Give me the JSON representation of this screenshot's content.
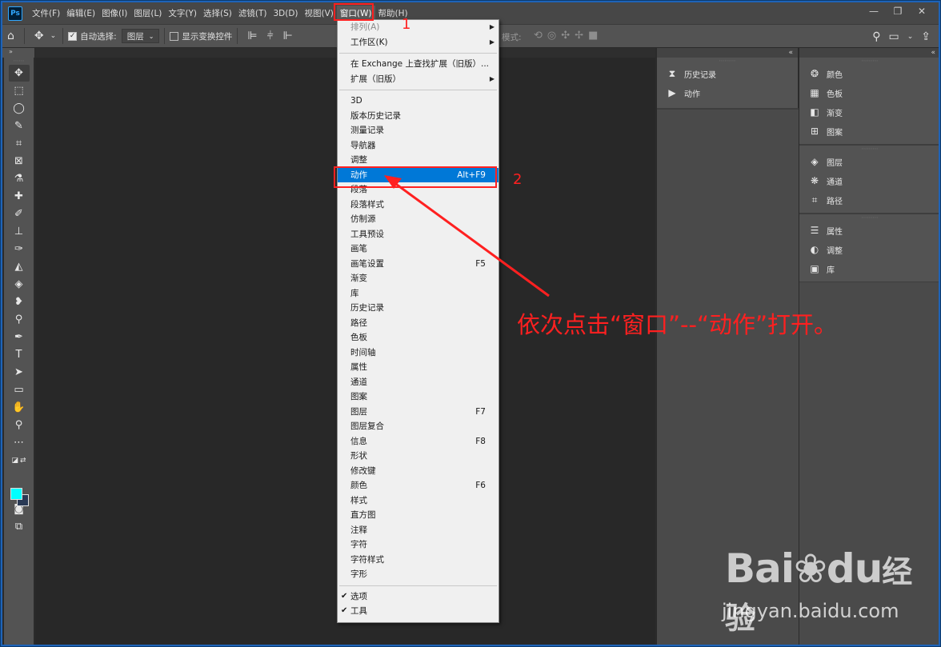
{
  "app": {
    "logo": "Ps"
  },
  "menubar": {
    "items": [
      "文件(F)",
      "编辑(E)",
      "图像(I)",
      "图层(L)",
      "文字(Y)",
      "选择(S)",
      "滤镜(T)",
      "3D(D)",
      "视图(V)",
      "窗口(W)",
      "帮助(H)"
    ],
    "active": "窗口(W)"
  },
  "window_controls": {
    "minimize": "—",
    "restore": "❐",
    "close": "✕"
  },
  "options": {
    "auto_select_label": "自动选择:",
    "layer_select": "图层",
    "show_transform_label": "显示变换控件",
    "mode_label": "模式:"
  },
  "dropdown": {
    "group1": [
      {
        "label": "排列(A)",
        "submenu": true,
        "disabled": true
      },
      {
        "label": "工作区(K)",
        "submenu": true
      }
    ],
    "group2": [
      {
        "label": "在 Exchange 上查找扩展（旧版）..."
      },
      {
        "label": "扩展（旧版）",
        "submenu": true
      }
    ],
    "group3": [
      {
        "label": "3D"
      },
      {
        "label": "版本历史记录"
      },
      {
        "label": "测量记录"
      },
      {
        "label": "导航器"
      },
      {
        "label": "调整"
      },
      {
        "label": "动作",
        "shortcut": "Alt+F9",
        "highlight": true
      },
      {
        "label": "段落"
      },
      {
        "label": "段落样式"
      },
      {
        "label": "仿制源"
      },
      {
        "label": "工具预设"
      },
      {
        "label": "画笔"
      },
      {
        "label": "画笔设置",
        "shortcut": "F5"
      },
      {
        "label": "渐变"
      },
      {
        "label": "库"
      },
      {
        "label": "历史记录"
      },
      {
        "label": "路径"
      },
      {
        "label": "色板"
      },
      {
        "label": "时间轴"
      },
      {
        "label": "属性"
      },
      {
        "label": "通道"
      },
      {
        "label": "图案"
      },
      {
        "label": "图层",
        "shortcut": "F7"
      },
      {
        "label": "图层复合"
      },
      {
        "label": "信息",
        "shortcut": "F8"
      },
      {
        "label": "形状"
      },
      {
        "label": "修改键"
      },
      {
        "label": "颜色",
        "shortcut": "F6"
      },
      {
        "label": "样式"
      },
      {
        "label": "直方图"
      },
      {
        "label": "注释"
      },
      {
        "label": "字符"
      },
      {
        "label": "字符样式"
      },
      {
        "label": "字形"
      }
    ],
    "group4": [
      {
        "label": "选项",
        "checked": true
      },
      {
        "label": "工具",
        "checked": true
      }
    ]
  },
  "panels": {
    "col1": [
      {
        "icon": "history-icon",
        "glyph": "⧗",
        "label": "历史记录"
      },
      {
        "icon": "play-icon",
        "glyph": "▶",
        "label": "动作"
      }
    ],
    "col2_groups": [
      [
        {
          "icon": "color-icon",
          "glyph": "❂",
          "label": "颜色"
        },
        {
          "icon": "swatches-icon",
          "glyph": "▦",
          "label": "色板"
        },
        {
          "icon": "gradient-icon",
          "glyph": "◧",
          "label": "渐变"
        },
        {
          "icon": "pattern-icon",
          "glyph": "⊞",
          "label": "图案"
        }
      ],
      [
        {
          "icon": "layers-icon",
          "glyph": "◈",
          "label": "图层"
        },
        {
          "icon": "channels-icon",
          "glyph": "❋",
          "label": "通道"
        },
        {
          "icon": "paths-icon",
          "glyph": "⌗",
          "label": "路径"
        }
      ],
      [
        {
          "icon": "properties-icon",
          "glyph": "☰",
          "label": "属性"
        },
        {
          "icon": "adjustments-icon",
          "glyph": "◐",
          "label": "调整"
        },
        {
          "icon": "library-icon",
          "glyph": "▣",
          "label": "库"
        }
      ]
    ]
  },
  "annotations": {
    "step1": "1",
    "step2": "2",
    "instruction": "依次点击“窗口”--“动作”打开。"
  },
  "watermark": {
    "logo_latin_1": "Bai",
    "logo_latin_2": "du",
    "logo_cn": "经验",
    "url": "jingyan.baidu.com"
  },
  "colors": {
    "accent": "#0078d7",
    "annotation": "#ff2020",
    "foreground_swatch": "#00ffff"
  }
}
